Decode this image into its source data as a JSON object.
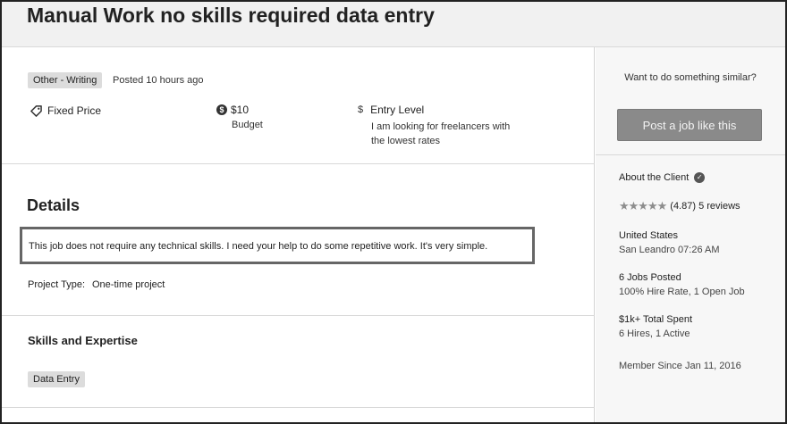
{
  "job": {
    "title": "Manual Work no skills required data entry",
    "category": "Other - Writing",
    "posted": "Posted 10 hours ago",
    "price_type": "Fixed Price",
    "budget_value": "$10",
    "budget_label": "Budget",
    "level_symbol": "$",
    "level_title": "Entry Level",
    "level_desc": "I am looking for freelancers with the lowest rates"
  },
  "details": {
    "heading": "Details",
    "description": "This job does not require any technical skills. I need your help to do some repetitive work. It's very simple.",
    "project_type_label": "Project Type:",
    "project_type_value": "One-time project"
  },
  "skills": {
    "heading": "Skills and Expertise",
    "tags": [
      "Data Entry"
    ]
  },
  "sidebar": {
    "similar_prompt": "Want to do something similar?",
    "post_button": "Post a job like this",
    "about_client": "About the Client",
    "stars": "★★★★★",
    "rating": "(4.87) 5 reviews",
    "country": "United States",
    "city_time": "San Leandro 07:26 AM",
    "jobs_posted": "6 Jobs Posted",
    "hire_rate": "100% Hire Rate, 1 Open Job",
    "total_spent": "$1k+ Total Spent",
    "hires": "6 Hires, 1 Active",
    "member_since": "Member Since Jan 11, 2016"
  },
  "icons": {
    "price": "tag-icon",
    "budget": "dollar-coin-icon",
    "level": "dollar-sign-icon",
    "verified": "verified-check-icon",
    "rating": "star-icon"
  }
}
